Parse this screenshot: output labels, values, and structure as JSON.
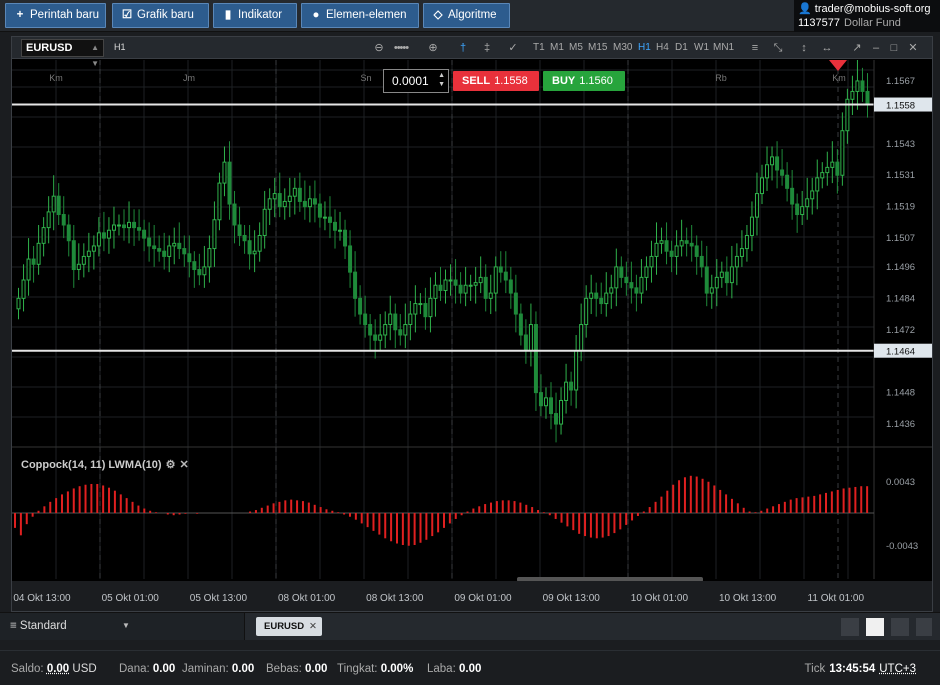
{
  "toolbar": {
    "buttons": [
      {
        "label": "Perintah baru",
        "icon": "plus-icon"
      },
      {
        "label": "Grafik baru",
        "icon": "chart-icon"
      },
      {
        "label": "Indikator",
        "icon": "bars-icon"
      },
      {
        "label": "Elemen-elemen",
        "icon": "shapes-icon"
      },
      {
        "label": "Algoritme",
        "icon": "diamond-icon"
      }
    ]
  },
  "account": {
    "email": "trader@mobius-soft.org",
    "number": "1137577",
    "currency": "Dollar Fund"
  },
  "chart": {
    "symbol": "EURUSD",
    "timeframe": "H1",
    "timeframes": [
      "T1",
      "M1",
      "M5",
      "M15",
      "M30",
      "H1",
      "H4",
      "D1",
      "W1",
      "MN1"
    ],
    "active_timeframe": "H1",
    "precision": "0.0001",
    "sell_label": "SELL",
    "sell_price": "1.1558",
    "buy_label": "BUY",
    "buy_price": "1.1560",
    "indicator_label": "Coppock(14, 11) LWMA(10)",
    "colors": {
      "up": "#2fb24b",
      "indicator": "#e02020",
      "sell": "#e8313b",
      "buy": "#27a43c",
      "accent": "#3ea6ff"
    }
  },
  "chart_data": {
    "type": "candlestick",
    "y_axis_ticks": [
      "1.1567",
      "1.1543",
      "1.1531",
      "1.1519",
      "1.1507",
      "1.1496",
      "1.1484",
      "1.1472",
      "1.1448",
      "1.1436"
    ],
    "price_lines": [
      "1.1558",
      "1.1464"
    ],
    "ylim": [
      1.1428,
      1.1575
    ],
    "x_axis_labels": [
      "04 Okt 13:00",
      "05 Okt 01:00",
      "05 Okt 13:00",
      "08 Okt 01:00",
      "08 Okt 13:00",
      "09 Okt 01:00",
      "09 Okt 13:00",
      "10 Okt 01:00",
      "10 Okt 13:00",
      "11 Okt 01:00"
    ],
    "day_labels": [
      "Km",
      "Jm",
      "Sn",
      "Rb",
      "Km"
    ],
    "closes": [
      1.1484,
      1.1491,
      1.1499,
      1.1497,
      1.1505,
      1.1511,
      1.1517,
      1.1523,
      1.1516,
      1.1512,
      1.1506,
      1.1495,
      1.1497,
      1.15,
      1.1502,
      1.1504,
      1.1509,
      1.1507,
      1.151,
      1.1512,
      1.1512,
      1.1511,
      1.1513,
      1.1511,
      1.151,
      1.1507,
      1.1504,
      1.1503,
      1.1502,
      1.15,
      1.1504,
      1.1505,
      1.1503,
      1.1501,
      1.1498,
      1.1495,
      1.1493,
      1.1496,
      1.1503,
      1.1514,
      1.1528,
      1.1536,
      1.152,
      1.1512,
      1.1508,
      1.1506,
      1.1501,
      1.1502,
      1.1508,
      1.1518,
      1.1522,
      1.1524,
      1.1519,
      1.1521,
      1.1523,
      1.1526,
      1.1521,
      1.1519,
      1.1522,
      1.152,
      1.1515,
      1.1515,
      1.1513,
      1.151,
      1.151,
      1.1504,
      1.1494,
      1.1484,
      1.1478,
      1.1474,
      1.147,
      1.1468,
      1.147,
      1.1474,
      1.1478,
      1.1472,
      1.147,
      1.1474,
      1.1478,
      1.1482,
      1.1482,
      1.1477,
      1.1484,
      1.1489,
      1.1487,
      1.1491,
      1.1491,
      1.1489,
      1.1486,
      1.1489,
      1.1489,
      1.149,
      1.1492,
      1.1484,
      1.1486,
      1.1496,
      1.1494,
      1.1491,
      1.1486,
      1.1478,
      1.147,
      1.1464,
      1.1474,
      1.1448,
      1.1443,
      1.1446,
      1.144,
      1.1436,
      1.1445,
      1.1452,
      1.1449,
      1.1464,
      1.1474,
      1.1484,
      1.1486,
      1.1484,
      1.1482,
      1.1486,
      1.1488,
      1.1496,
      1.1492,
      1.149,
      1.1488,
      1.1486,
      1.1492,
      1.1496,
      1.15,
      1.1505,
      1.1506,
      1.1502,
      1.15,
      1.1504,
      1.1506,
      1.1505,
      1.1504,
      1.15,
      1.1496,
      1.1486,
      1.1488,
      1.1492,
      1.1494,
      1.149,
      1.1496,
      1.15,
      1.1503,
      1.1508,
      1.1515,
      1.1524,
      1.153,
      1.1535,
      1.1538,
      1.1533,
      1.1531,
      1.1526,
      1.152,
      1.1516,
      1.1519,
      1.1522,
      1.1525,
      1.153,
      1.1532,
      1.1534,
      1.1536,
      1.1531,
      1.1548,
      1.156,
      1.1563,
      1.1567,
      1.1563,
      1.1558
    ],
    "indicator_values": [
      -0.002,
      -0.003,
      -0.0015,
      -0.0005,
      0.0003,
      0.0009,
      0.0015,
      0.002,
      0.0025,
      0.0029,
      0.0033,
      0.0036,
      0.0038,
      0.0039,
      0.0039,
      0.0037,
      0.0034,
      0.003,
      0.0025,
      0.002,
      0.0015,
      0.001,
      0.0006,
      0.0003,
      0.0001,
      0.0,
      -0.0002,
      -0.0003,
      -0.0002,
      -0.0001,
      0.0,
      -0.0001,
      0.0,
      0.0,
      0.0,
      0.0,
      0.0,
      0.0,
      0.0,
      0.0,
      0.0002,
      0.0004,
      0.0007,
      0.001,
      0.0013,
      0.0015,
      0.0017,
      0.0018,
      0.0017,
      0.0016,
      0.0014,
      0.0011,
      0.0008,
      0.0005,
      0.0003,
      0.0001,
      -0.0002,
      -0.0005,
      -0.0009,
      -0.0014,
      -0.0019,
      -0.0024,
      -0.0029,
      -0.0034,
      -0.0038,
      -0.0041,
      -0.0043,
      -0.0044,
      -0.0043,
      -0.004,
      -0.0036,
      -0.0031,
      -0.0026,
      -0.002,
      -0.0014,
      -0.0008,
      -0.0003,
      0.0002,
      0.0006,
      0.0009,
      0.0012,
      0.0014,
      0.0016,
      0.0017,
      0.0017,
      0.0016,
      0.0014,
      0.0011,
      0.0008,
      0.0004,
      0.0001,
      -0.0003,
      -0.0008,
      -0.0013,
      -0.0018,
      -0.0023,
      -0.0028,
      -0.0031,
      -0.0033,
      -0.0034,
      -0.0033,
      -0.0031,
      -0.0027,
      -0.0022,
      -0.0016,
      -0.001,
      -0.0004,
      0.0002,
      0.0008,
      0.0015,
      0.0022,
      0.003,
      0.0038,
      0.0044,
      0.0048,
      0.005,
      0.0049,
      0.0046,
      0.0042,
      0.0037,
      0.0031,
      0.0025,
      0.0019,
      0.0013,
      0.0007,
      0.0002,
      0.0001,
      0.0003,
      0.0006,
      0.0009,
      0.0012,
      0.0015,
      0.0018,
      0.002,
      0.0021,
      0.0022,
      0.0023,
      0.0025,
      0.0027,
      0.0029,
      0.0031,
      0.0033,
      0.0034,
      0.0035,
      0.0036,
      0.0036
    ],
    "indicator_ticks": [
      "0.0043",
      "-0.0043"
    ]
  },
  "workspace": {
    "name": "Standard",
    "tab": "EURUSD"
  },
  "status": {
    "saldo_label": "Saldo:",
    "saldo_value": "0.00",
    "saldo_cur": "USD",
    "dana_label": "Dana:",
    "dana_value": "0.00",
    "jaminan_label": "Jaminan:",
    "jaminan_value": "0.00",
    "bebas_label": "Bebas:",
    "bebas_value": "0.00",
    "tingkat_label": "Tingkat:",
    "tingkat_value": "0.00%",
    "laba_label": "Laba:",
    "laba_value": "0.00",
    "tick_label": "Tick",
    "tick_time": "13:45:54",
    "timezone": "UTC+3"
  }
}
